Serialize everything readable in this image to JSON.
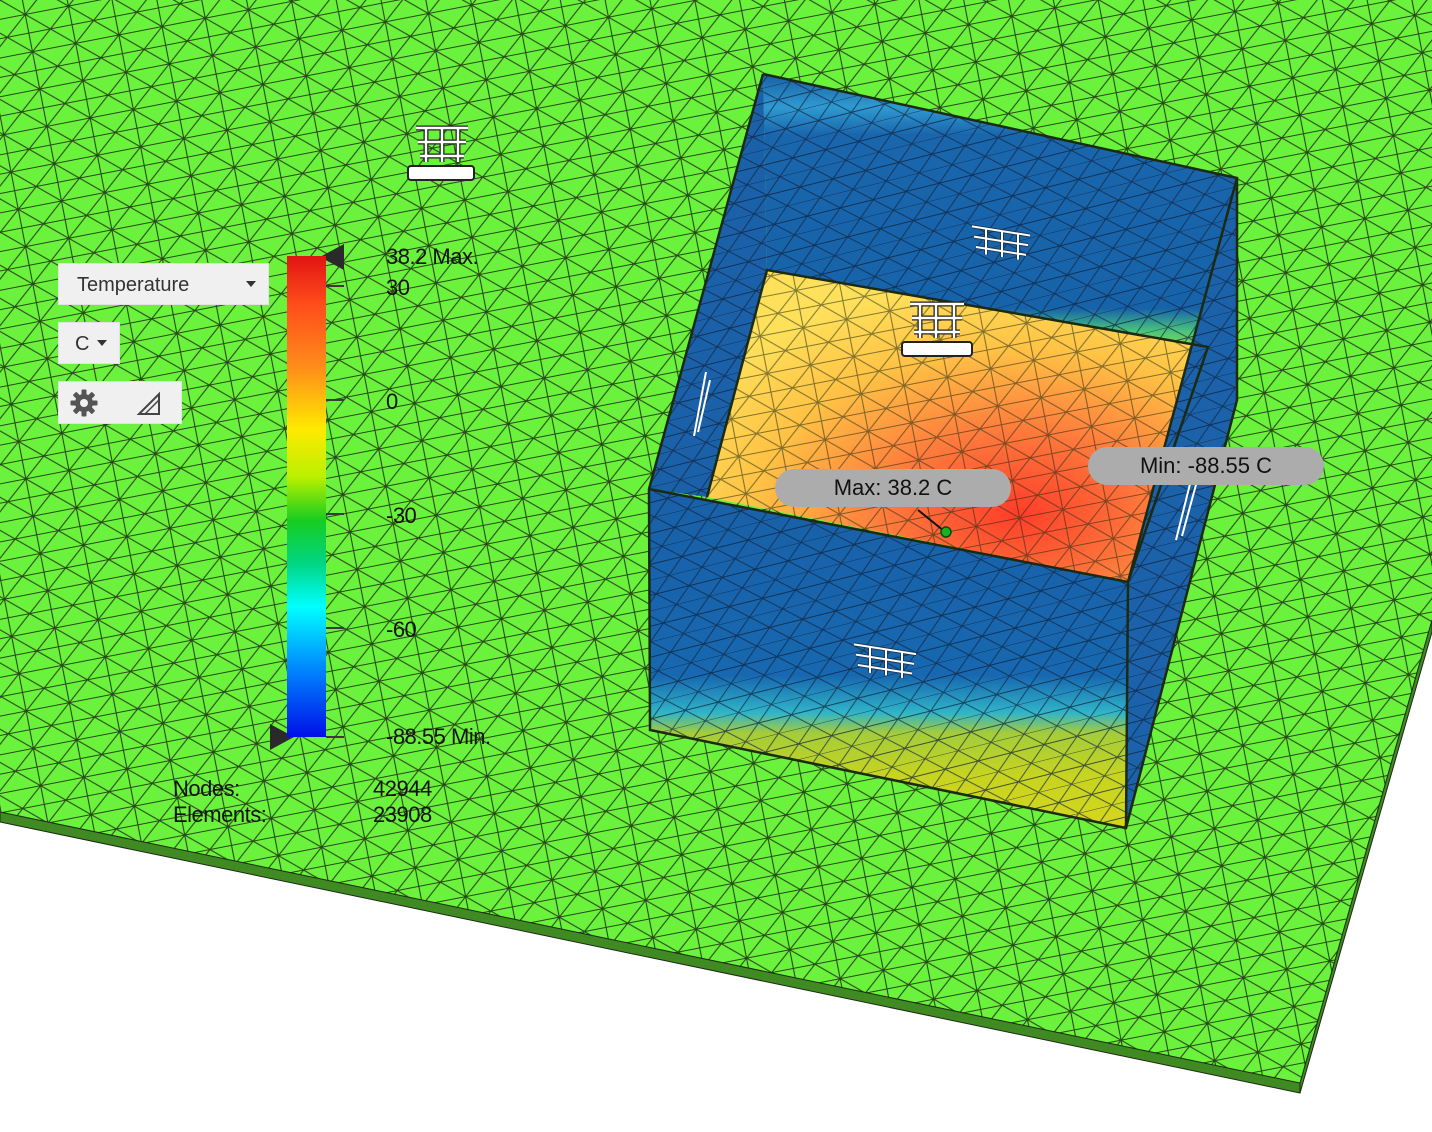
{
  "result_selector": {
    "value": "Temperature"
  },
  "unit_selector": {
    "value": "C"
  },
  "legend_tools": {
    "settings_icon": "gear-icon",
    "adjust_icon": "triangle-icon"
  },
  "legend": {
    "max_label": "38.2 Max.",
    "min_label": "-88.55 Min.",
    "ticks": [
      "30",
      "0",
      "-30",
      "-60"
    ],
    "colors": [
      "#e11313",
      "#ff8c1a",
      "#ffea00",
      "#17cc20",
      "#00ffff",
      "#0085ff",
      "#0010e8"
    ]
  },
  "stats": {
    "nodes_label": "Nodes:",
    "nodes_value": "42944",
    "elements_label": "Elements:",
    "elements_value": "23908"
  },
  "probes": {
    "max": "Max: 38.2 C",
    "min": "Min: -88.55 C"
  },
  "colors": {
    "ground": "#6bf23c",
    "wall_cold": "#1767ad",
    "floor_hot": "#ff6a36",
    "mesh_line": "#1c2a12"
  }
}
